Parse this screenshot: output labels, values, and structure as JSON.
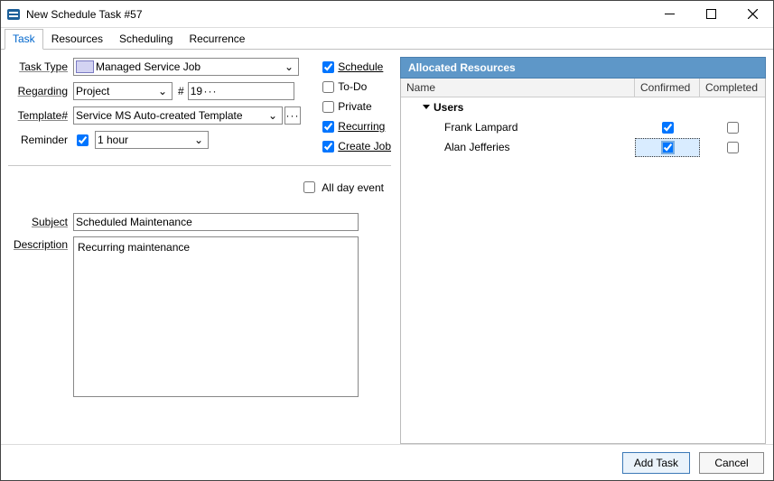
{
  "window": {
    "title": "New Schedule Task #57"
  },
  "tabs": [
    "Task",
    "Resources",
    "Scheduling",
    "Recurrence"
  ],
  "active_tab": "Task",
  "form": {
    "task_type": {
      "label": "Task Type",
      "value": "Managed Service Job"
    },
    "regarding": {
      "label": "Regarding",
      "value": "Project",
      "hash_label": "#",
      "hash_value": "19"
    },
    "template": {
      "label": "Template#",
      "value": "Service MS Auto-created Template"
    },
    "reminder": {
      "label": "Reminder",
      "checked": true,
      "value": "1 hour"
    }
  },
  "flags": {
    "schedule": {
      "label": "Schedule",
      "checked": true
    },
    "todo": {
      "label": "To-Do",
      "checked": false
    },
    "private": {
      "label": "Private",
      "checked": false
    },
    "recurring": {
      "label": "Recurring",
      "checked": true
    },
    "create_job": {
      "label": "Create Job",
      "checked": true
    }
  },
  "all_day": {
    "label": "All day event",
    "checked": false
  },
  "subject": {
    "label": "Subject",
    "value": "Scheduled Maintenance"
  },
  "description": {
    "label": "Description",
    "value": "Recurring maintenance"
  },
  "resources": {
    "title": "Allocated Resources",
    "columns": {
      "name": "Name",
      "confirmed": "Confirmed",
      "completed": "Completed"
    },
    "group_label": "Users",
    "rows": [
      {
        "name": "Frank Lampard",
        "confirmed": true,
        "completed": false,
        "selected": false
      },
      {
        "name": "Alan Jefferies",
        "confirmed": true,
        "completed": false,
        "selected": true
      }
    ]
  },
  "footer": {
    "primary": "Add Task",
    "cancel": "Cancel"
  }
}
